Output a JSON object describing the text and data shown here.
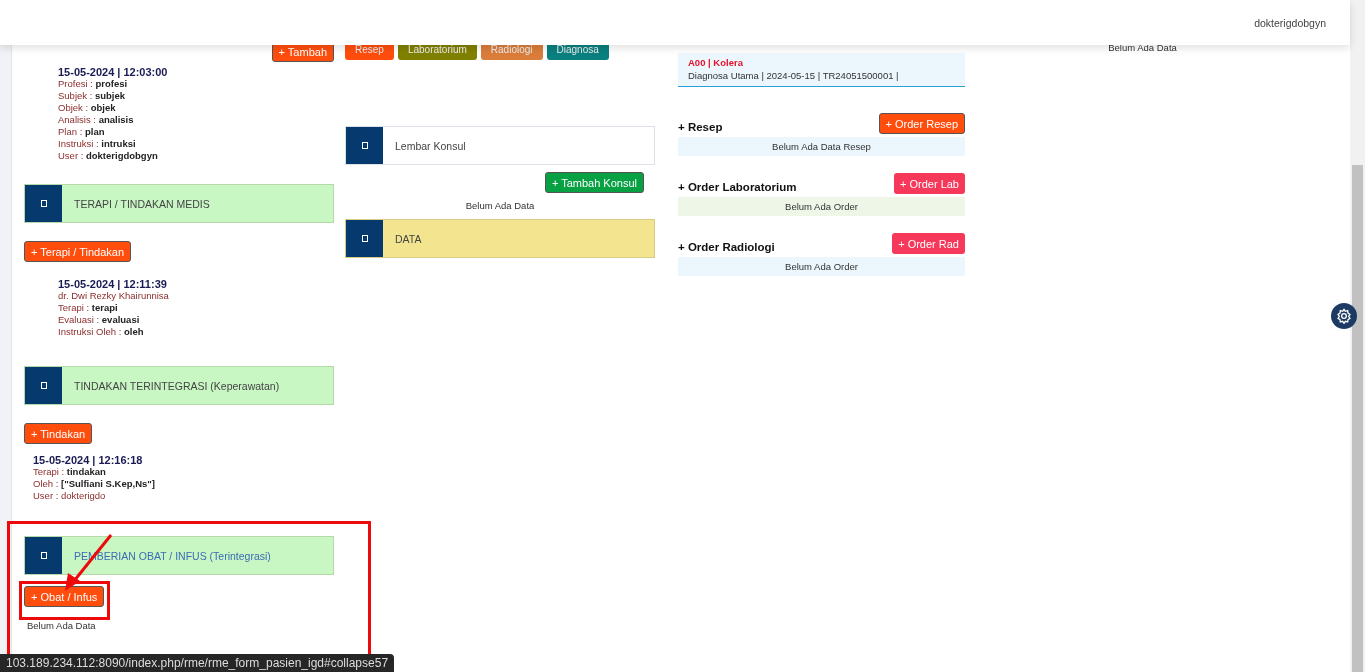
{
  "header": {
    "user": "dokterigdobgyn"
  },
  "left": {
    "add_button": "+ Tambah",
    "entries": [
      {
        "datetime": "15-05-2024 | 12:03:00",
        "indent": true,
        "lines": [
          {
            "kind": "field",
            "label": "Profesi :",
            "value": "profesi"
          },
          {
            "kind": "field",
            "label": "Subjek :",
            "value": "subjek"
          },
          {
            "kind": "field",
            "label": "Objek :",
            "value": "objek"
          },
          {
            "kind": "field",
            "label": "Analisis :",
            "value": "analisis"
          },
          {
            "kind": "field",
            "label": "Plan :",
            "value": "plan"
          },
          {
            "kind": "field",
            "label": "Instruksi :",
            "value": "intruksi"
          },
          {
            "kind": "field",
            "label": "User :",
            "value": "dokterigdobgyn"
          }
        ]
      }
    ],
    "sections": [
      {
        "title": "TERAPI / TINDAKAN MEDIS",
        "color": "#444444",
        "button": "+ Terapi / Tindakan",
        "entries": [
          {
            "datetime": "15-05-2024 | 12:11:39",
            "indent": true,
            "lines": [
              {
                "kind": "plain",
                "text": "dr. Dwi Rezky Khairunnisa"
              },
              {
                "kind": "field",
                "label": "Terapi :",
                "value": "terapi"
              },
              {
                "kind": "field",
                "label": "Evaluasi :",
                "value": "evaluasi"
              },
              {
                "kind": "field",
                "label": "Instruksi Oleh :",
                "value": "oleh"
              }
            ]
          }
        ]
      },
      {
        "title": "TINDAKAN TERINTEGRASI (Keperawatan)",
        "color": "#444444",
        "button": "+ Tindakan",
        "entries": [
          {
            "datetime": "15-05-2024 | 12:16:18",
            "indent": false,
            "lines": [
              {
                "kind": "field",
                "label": "Terapi :",
                "value": "tindakan"
              },
              {
                "kind": "field",
                "label": "Oleh :",
                "value": "[\"Sulfiani S.Kep,Ns\"]"
              },
              {
                "kind": "plain",
                "text": "User : dokterigdo"
              }
            ]
          }
        ]
      },
      {
        "title": "PEMBERIAN OBAT / INFUS (Terintegrasi)",
        "color": "#3b6db3",
        "button": "+ Obat / Infus",
        "empty": "Belum Ada Data"
      }
    ]
  },
  "middle": {
    "tabs": [
      {
        "label": "Resep",
        "color": "#ff4d0d"
      },
      {
        "label": "Laboratorium",
        "color": "#808000"
      },
      {
        "label": "Radiologi",
        "color": "#db7d3a"
      },
      {
        "label": "Diagnosa",
        "color": "#0a7f7f"
      }
    ],
    "konsul": {
      "title": "Lembar Konsul",
      "button": "+ Tambah Konsul",
      "empty": "Belum Ada Data"
    },
    "data_card": {
      "title": "DATA"
    }
  },
  "right": {
    "diagnosis": {
      "code": "A00 | Kolera",
      "detail": "Diagnosa Utama | 2024-05-15 | TR24051500001 |"
    },
    "orders": [
      {
        "title": "+ Resep",
        "button": "+ Order Resep",
        "color": "#ff4d0d",
        "kind": "resep",
        "empty": "Belum Ada Data Resep"
      },
      {
        "title": "+ Order Laboratorium",
        "button": "+ Order Lab",
        "color": "#f6395a",
        "kind": "lab",
        "empty": "Belum Ada Order"
      },
      {
        "title": "+ Order Radiologi",
        "button": "+ Order Rad",
        "color": "#f6395a",
        "kind": "rad",
        "empty": "Belum Ada Order"
      }
    ]
  },
  "side": {
    "empty": "Belum Ada Data"
  },
  "status_url": "103.189.234.112:8090/index.php/rme/rme_form_pasien_igd#collapse57"
}
